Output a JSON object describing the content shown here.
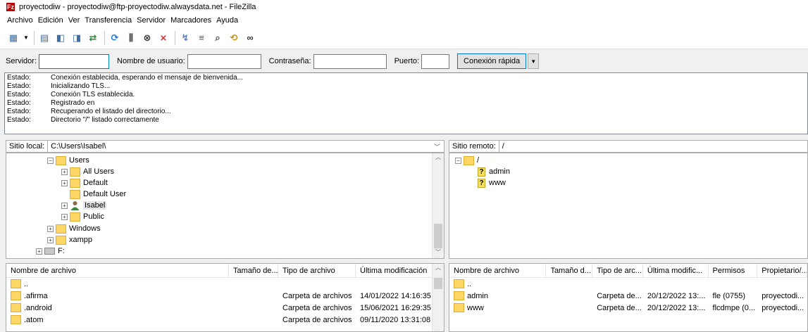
{
  "window": {
    "title": "proyectodiw - proyectodiw@ftp-proyectodiw.alwaysdata.net - FileZilla",
    "app_icon": "Fz"
  },
  "menu": [
    "Archivo",
    "Edición",
    "Ver",
    "Transferencia",
    "Servidor",
    "Marcadores",
    "Ayuda"
  ],
  "quickconnect": {
    "server_label": "Servidor:",
    "server_value": "",
    "user_label": "Nombre de usuario:",
    "user_value": "",
    "pass_label": "Contraseña:",
    "pass_value": "",
    "port_label": "Puerto:",
    "port_value": "",
    "button": "Conexión rápida"
  },
  "log": [
    {
      "k": "Estado:",
      "v": "Conexión establecida, esperando el mensaje de bienvenida..."
    },
    {
      "k": "Estado:",
      "v": "Inicializando TLS..."
    },
    {
      "k": "Estado:",
      "v": "Conexión TLS establecida."
    },
    {
      "k": "Estado:",
      "v": "Registrado en"
    },
    {
      "k": "Estado:",
      "v": "Recuperando el listado del directorio..."
    },
    {
      "k": "Estado:",
      "v": "Directorio \"/\" listado correctamente"
    }
  ],
  "local": {
    "label": "Sitio local:",
    "path": "C:\\Users\\Isabel\\",
    "tree": {
      "users": "Users",
      "all_users": "All Users",
      "default": "Default",
      "default_user": "Default User",
      "isabel": "Isabel",
      "public": "Public",
      "windows": "Windows",
      "xampp": "xampp",
      "f_drive": "F:"
    },
    "columns": [
      "Nombre de archivo",
      "Tamaño de...",
      "Tipo de archivo",
      "Última modificación"
    ],
    "files": [
      {
        "name": "..",
        "size": "",
        "type": "",
        "modified": ""
      },
      {
        "name": ".afirma",
        "size": "",
        "type": "Carpeta de archivos",
        "modified": "14/01/2022 14:16:35"
      },
      {
        "name": ".android",
        "size": "",
        "type": "Carpeta de archivos",
        "modified": "15/06/2021 16:29:35"
      },
      {
        "name": ".atom",
        "size": "",
        "type": "Carpeta de archivos",
        "modified": "09/11/2020 13:31:08"
      }
    ]
  },
  "remote": {
    "label": "Sitio remoto:",
    "path": "/",
    "tree": {
      "root": "/",
      "admin": "admin",
      "www": "www",
      "unknown_mark": "?"
    },
    "columns": [
      "Nombre de archivo",
      "Tamaño d...",
      "Tipo de arc...",
      "Última modific...",
      "Permisos",
      "Propietario/..."
    ],
    "files": [
      {
        "name": "..",
        "size": "",
        "type": "",
        "modified": "",
        "perms": "",
        "owner": ""
      },
      {
        "name": "admin",
        "size": "",
        "type": "Carpeta de...",
        "modified": "20/12/2022 13:...",
        "perms": "fle (0755)",
        "owner": "proyectodi..."
      },
      {
        "name": "www",
        "size": "",
        "type": "Carpeta de...",
        "modified": "20/12/2022 13:...",
        "perms": "flcdmpe (0...",
        "owner": "proyectodi..."
      }
    ]
  },
  "colors": {
    "folder": "#ffd767",
    "accent": "#0078d7",
    "title_icon": "#bf0000"
  }
}
